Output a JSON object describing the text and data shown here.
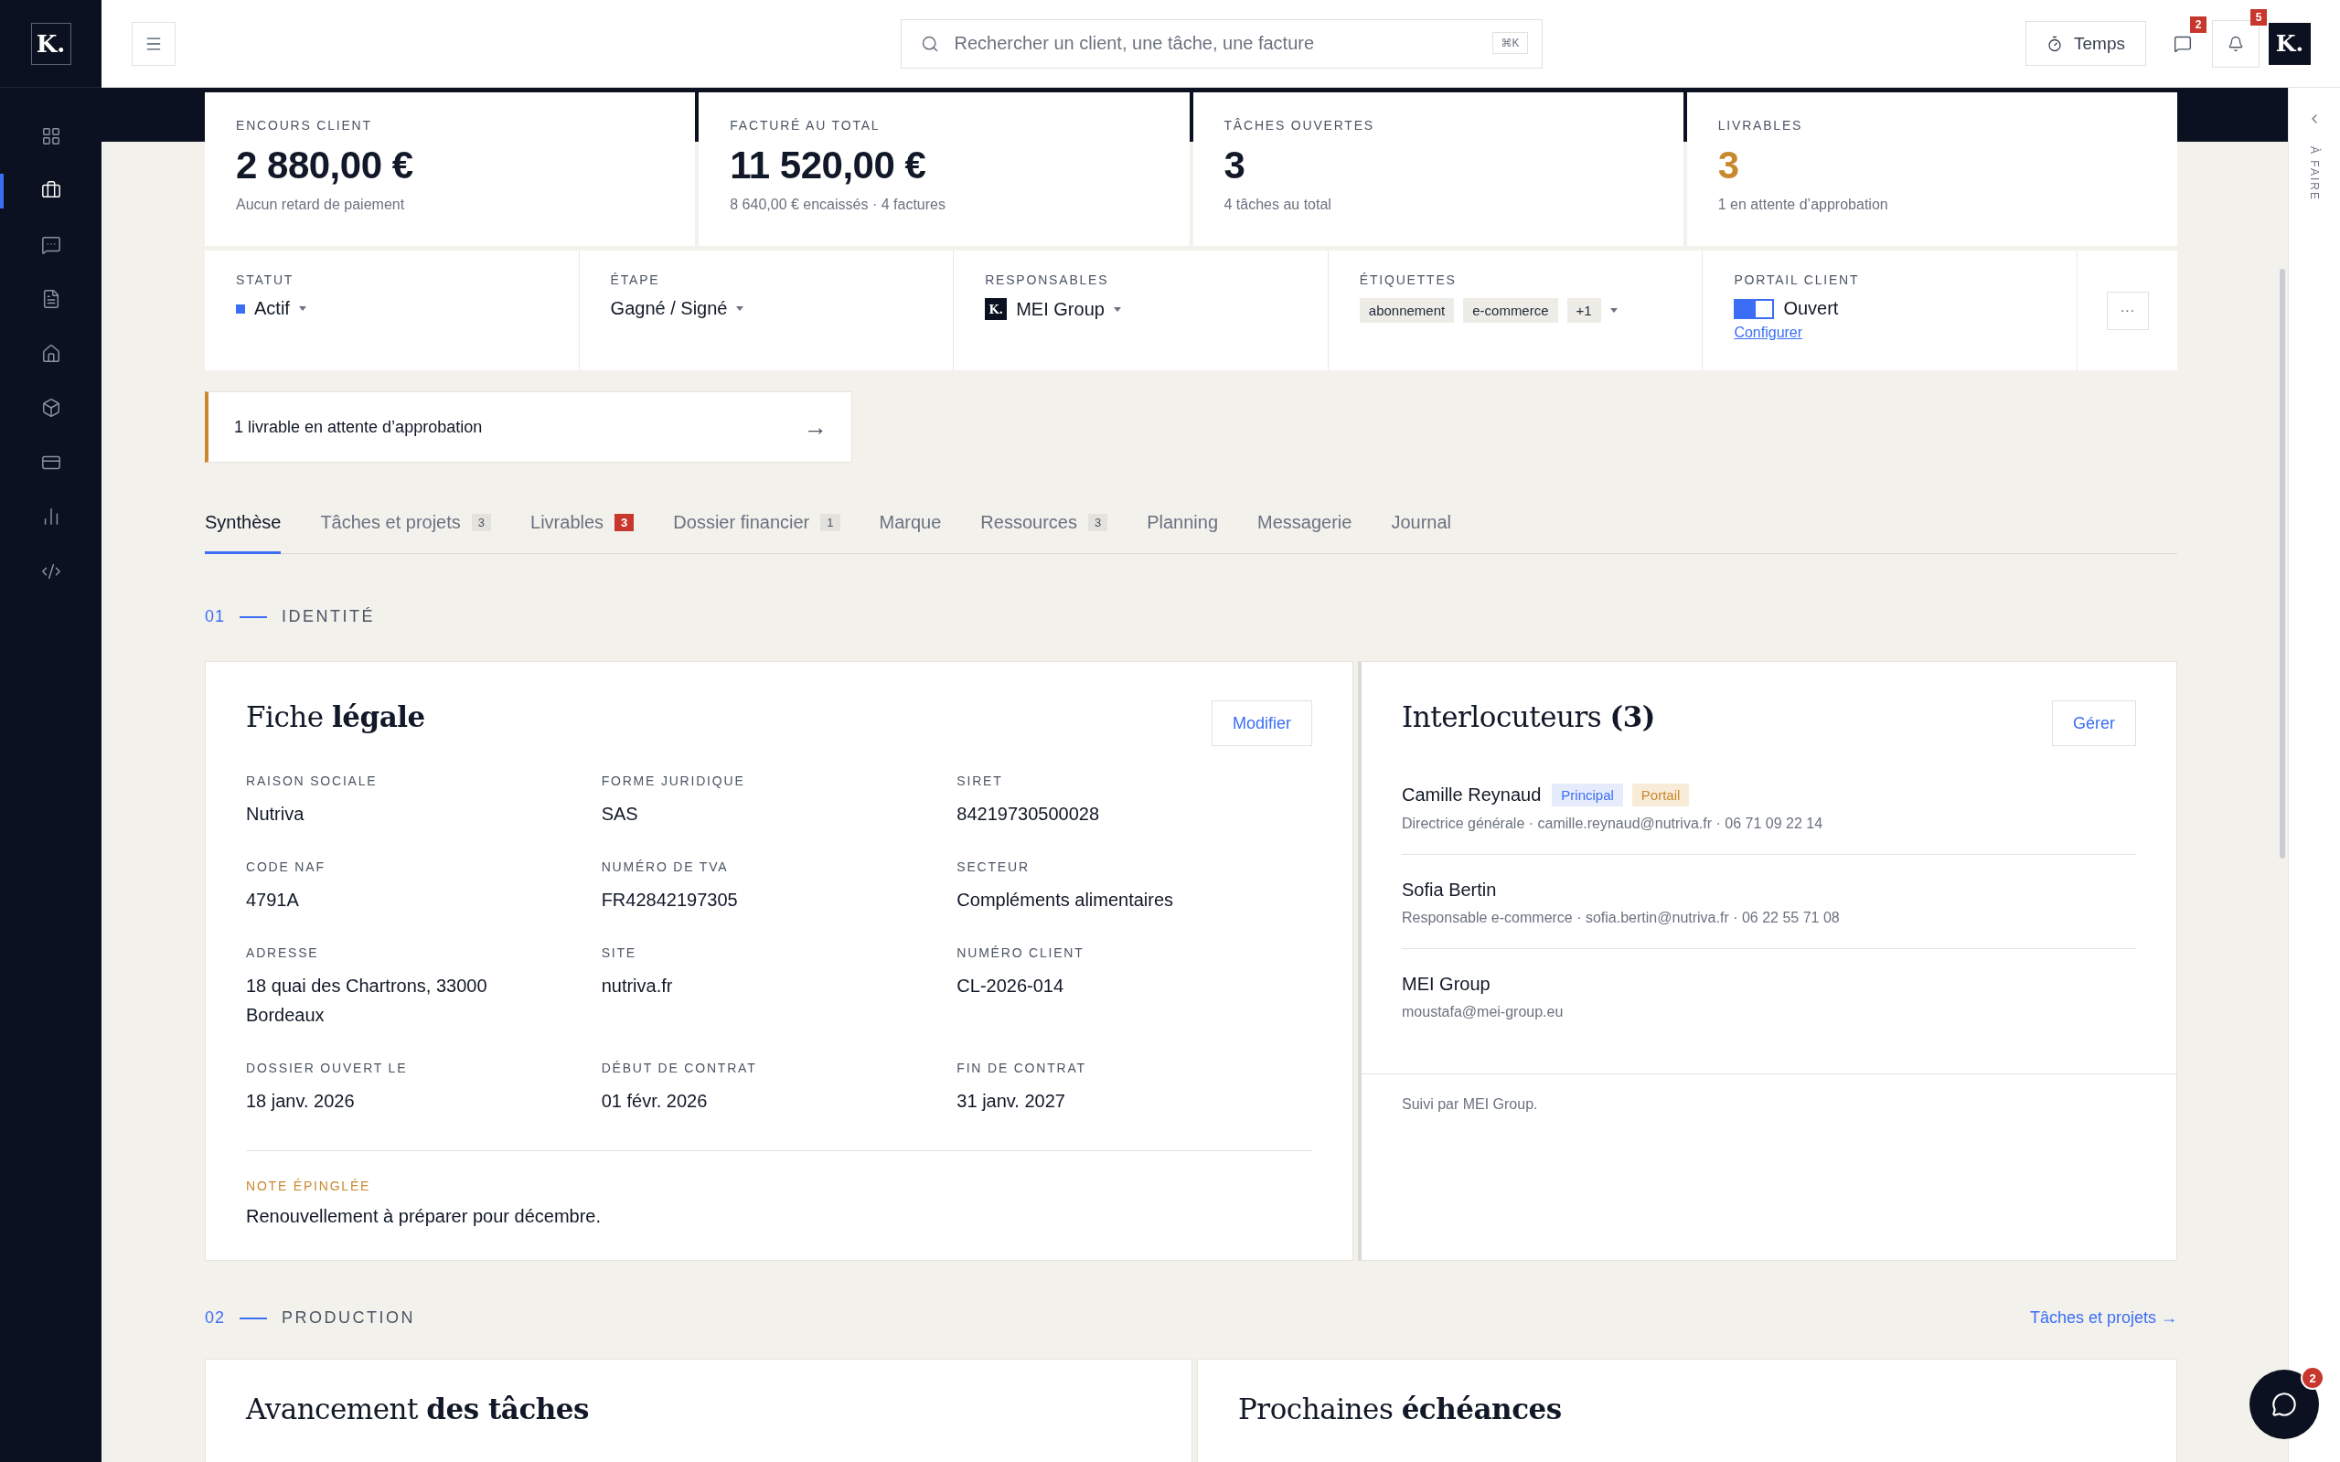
{
  "sidebar": {
    "logo": "K.",
    "items": [
      {
        "selected": false
      },
      {
        "selected": true
      },
      {
        "selected": false
      },
      {
        "selected": false
      },
      {
        "selected": false
      },
      {
        "selected": false
      },
      {
        "selected": false
      },
      {
        "selected": false
      },
      {
        "selected": false
      }
    ]
  },
  "topbar": {
    "search": {
      "placeholder": "Rechercher un client, une tâche, une facture",
      "shortcut": "⌘K"
    },
    "time_button": "Temps",
    "messages_badge": "2",
    "notifications_badge": "5",
    "avatar": "K."
  },
  "stats": [
    {
      "label": "ENCOURS CLIENT",
      "value": "2 880,00 €",
      "note": "Aucun retard de paiement",
      "accent": false
    },
    {
      "label": "FACTURÉ AU TOTAL",
      "value": "11 520,00 €",
      "note": "8 640,00 € encaissés · 4 factures",
      "accent": false
    },
    {
      "label": "TÂCHES OUVERTES",
      "value": "3",
      "note": "4 tâches au total",
      "accent": false
    },
    {
      "label": "LIVRABLES",
      "value": "3",
      "note": "1 en attente d’approbation",
      "accent": true
    }
  ],
  "info": [
    {
      "kind": "status",
      "label": "STATUT",
      "value": "Actif",
      "color": "#3b6ef5"
    },
    {
      "kind": "select",
      "label": "ÉTAPE",
      "value": "Gagné / Signé"
    },
    {
      "kind": "owner",
      "label": "RESPONSABLES",
      "value": "MEI Group",
      "avatar": "K."
    },
    {
      "kind": "tags",
      "label": "ÉTIQUETTES",
      "tags": [
        "abonnement",
        "e-commerce",
        "+1"
      ]
    },
    {
      "kind": "toggle",
      "label": "PORTAIL CLIENT",
      "on": true,
      "value": "Ouvert",
      "link": "Configurer"
    }
  ],
  "more_button": "···",
  "alert": {
    "text": "1 livrable en attente d’approbation",
    "arrow": "→"
  },
  "tabs": [
    {
      "label": "Synthèse",
      "selected": true
    },
    {
      "label": "Tâches et projets",
      "count": "3",
      "alert": false,
      "selected": false
    },
    {
      "label": "Livrables",
      "count": "3",
      "alert": true,
      "selected": false
    },
    {
      "label": "Dossier financier",
      "count": "1",
      "alert": false,
      "selected": false
    },
    {
      "label": "Marque",
      "selected": false
    },
    {
      "label": "Ressources",
      "count": "3",
      "alert": false,
      "selected": false
    },
    {
      "label": "Planning",
      "selected": false
    },
    {
      "label": "Messagerie",
      "selected": false
    },
    {
      "label": "Journal",
      "selected": false
    }
  ],
  "identity": {
    "number": "01",
    "title": "IDENTITÉ",
    "legal": {
      "title": "Fiche **légale**",
      "button": "Modifier",
      "fields": [
        {
          "label": "RAISON SOCIALE",
          "value": "Nutriva"
        },
        {
          "label": "FORME JURIDIQUE",
          "value": "SAS"
        },
        {
          "label": "SIRET",
          "value": "84219730500028"
        },
        {
          "label": "CODE NAF",
          "value": "4791A"
        },
        {
          "label": "NUMÉRO DE TVA",
          "value": "FR42842197305"
        },
        {
          "label": "SECTEUR",
          "value": "Compléments alimentaires"
        },
        {
          "label": "ADRESSE",
          "value": "18 quai des Chartrons, 33000 Bordeaux"
        },
        {
          "label": "SITE",
          "value": "nutriva.fr"
        },
        {
          "label": "NUMÉRO CLIENT",
          "value": "CL-2026-014"
        },
        {
          "label": "DOSSIER OUVERT LE",
          "value": "18 janv. 2026"
        },
        {
          "label": "DÉBUT DE CONTRAT",
          "value": "01 févr. 2026"
        },
        {
          "label": "FIN DE CONTRAT",
          "value": "31 janv. 2027"
        }
      ],
      "note": {
        "label": "NOTE ÉPINGLÉE",
        "text": "Renouvellement à préparer pour décembre."
      }
    },
    "contacts": {
      "title": "Interlocuteurs **(3)**",
      "button": "Gérer",
      "people": [
        {
          "name": "Camille Reynaud",
          "badges": [
            {
              "label": "Principal",
              "kind": "primary"
            },
            {
              "label": "Portail",
              "kind": "portal"
            }
          ],
          "details": "Directrice générale · camille.reynaud@nutriva.fr · 06 71 09 22 14"
        },
        {
          "name": "Sofia Bertin",
          "details": "Responsable e-commerce · sofia.bertin@nutriva.fr · 06 22 55 71 08"
        },
        {
          "name": "MEI Group",
          "details": "moustafa@mei-group.eu"
        }
      ],
      "footer": "Suivi par MEI Group."
    }
  },
  "production": {
    "number": "02",
    "title": "PRODUCTION",
    "link": "Tâches et projets →",
    "cards": [
      "Avancement **des tâches**",
      "Prochaines **échéances**"
    ]
  },
  "right_rail": {
    "label": "À FAIRE"
  },
  "chat": {
    "badge": "2"
  }
}
